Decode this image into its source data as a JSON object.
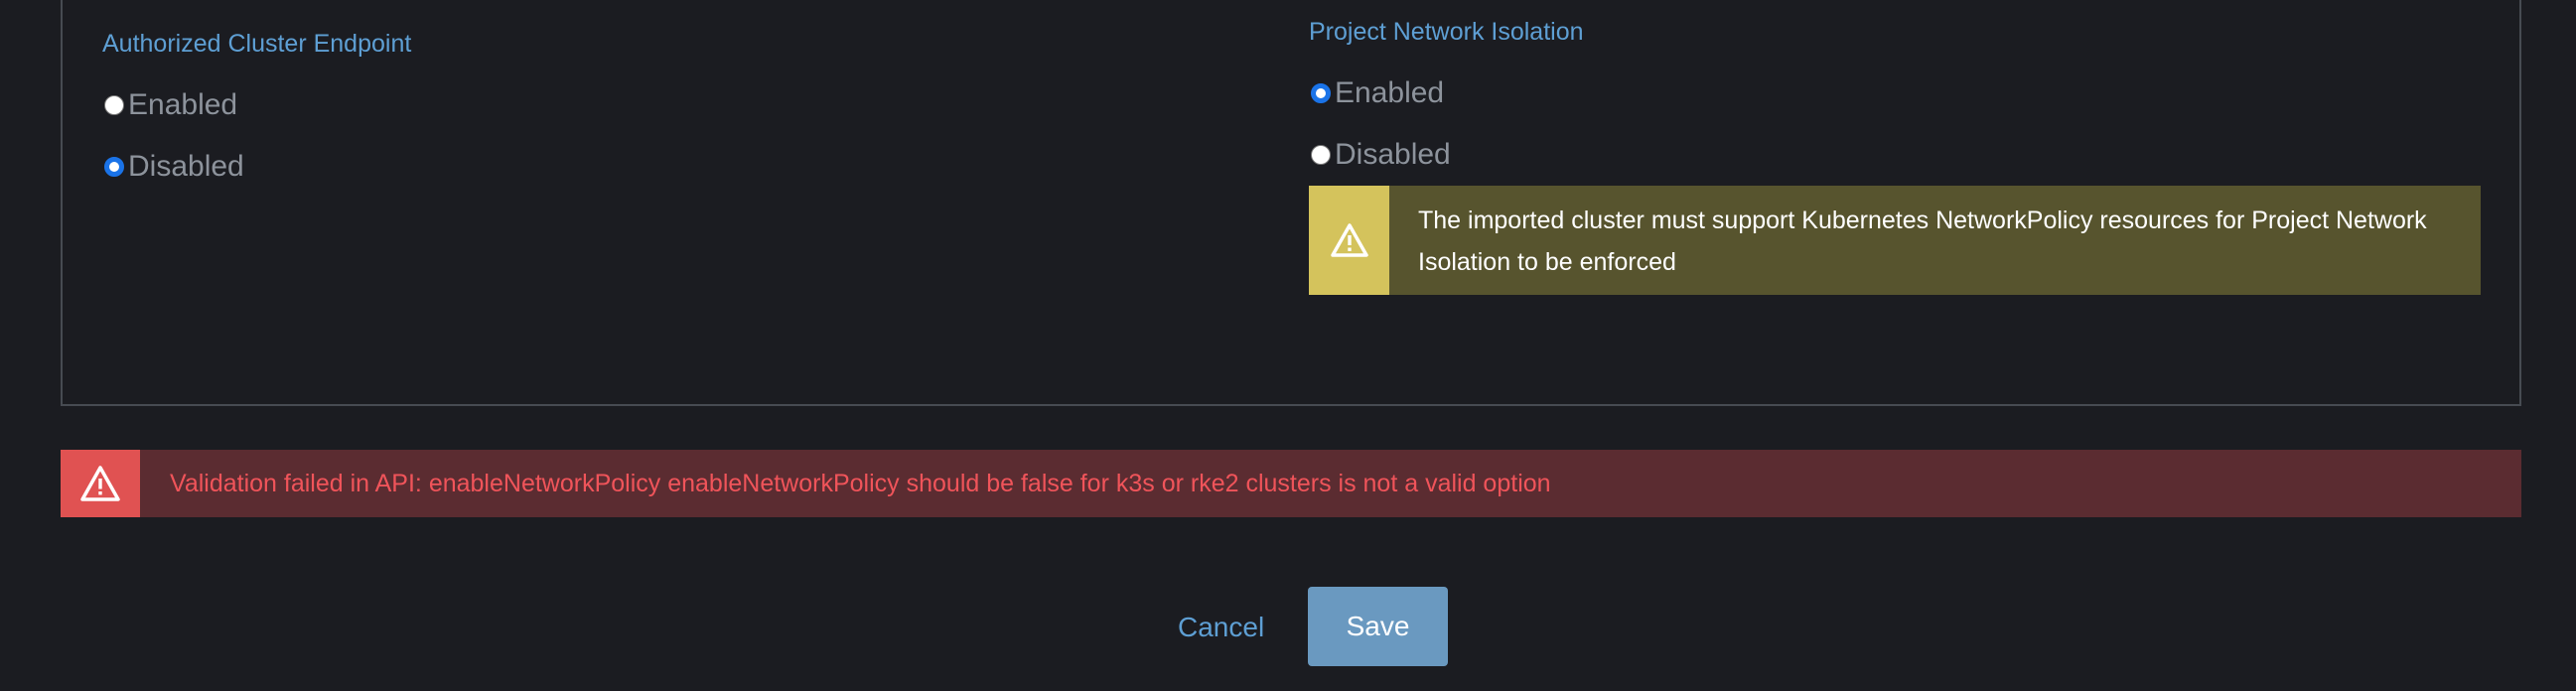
{
  "authorized_endpoint": {
    "title": "Authorized Cluster Endpoint",
    "options": [
      {
        "label": "Enabled",
        "checked": false
      },
      {
        "label": "Disabled",
        "checked": true
      }
    ]
  },
  "network_isolation": {
    "title": "Project Network Isolation",
    "options": [
      {
        "label": "Enabled",
        "checked": true
      },
      {
        "label": "Disabled",
        "checked": false
      }
    ],
    "warning": {
      "icon": "warning-icon",
      "line1": "The imported cluster must support Kubernetes NetworkPolicy resources for Project Network",
      "line2": "Isolation to be enforced"
    }
  },
  "error_banner": {
    "icon": "warning-icon",
    "message": "Validation failed in API: enableNetworkPolicy enableNetworkPolicy should be false for k3s or rke2 clusters is not a valid option"
  },
  "actions": {
    "cancel_label": "Cancel",
    "save_label": "Save"
  },
  "colors": {
    "accent_link": "#5e9fd4",
    "warning_bg": "#57542e",
    "warning_icon_bg": "#d4c35c",
    "error_bg": "#5b2c31",
    "error_icon_bg": "#e05252",
    "error_text": "#f0545a",
    "save_button": "#6a99c0"
  }
}
